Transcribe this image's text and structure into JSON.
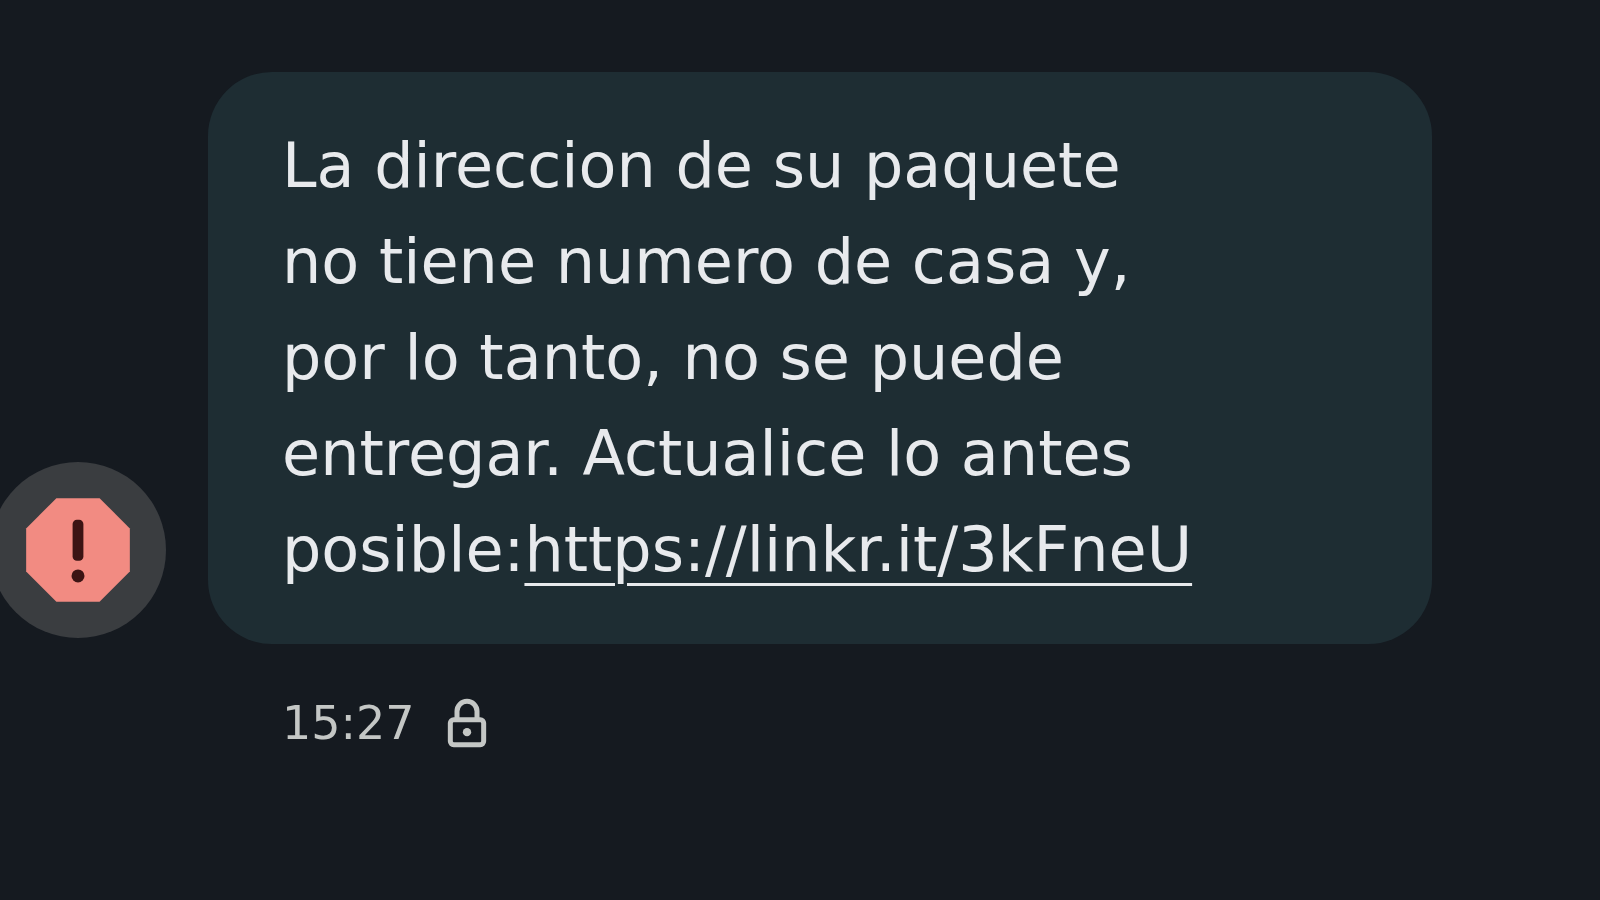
{
  "message": {
    "text": "La direccion de su paquete\nno tiene numero de casa y,\npor lo tanto, no se puede\nentregar. Actualice lo antes\nposible:",
    "link": "https://linkr.it/3kFneU",
    "time": "15:27",
    "encrypted": true,
    "spam_warning": true
  }
}
